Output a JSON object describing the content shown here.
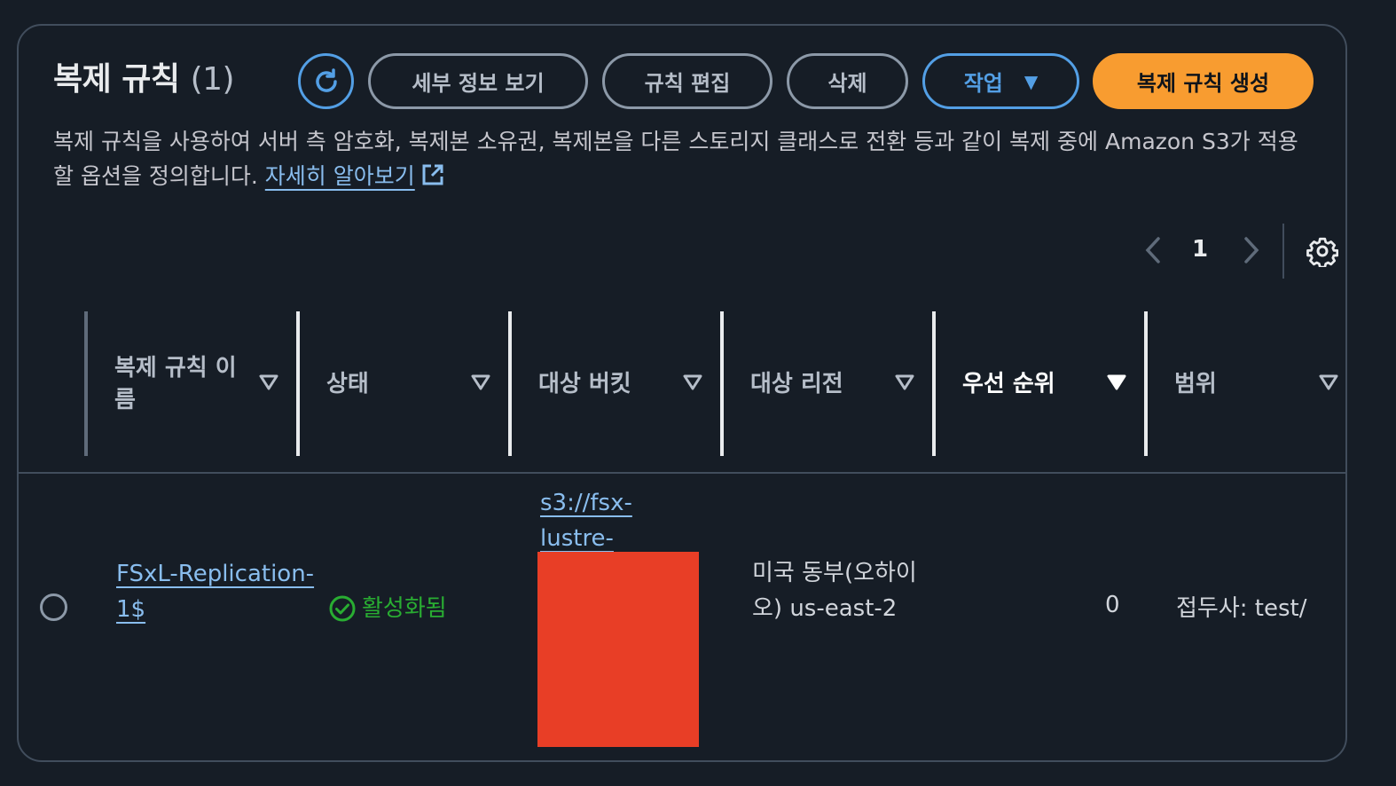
{
  "panel": {
    "title": "복제 규칙",
    "count": "(1)",
    "buttons": {
      "view_details": "세부 정보 보기",
      "edit_rule": "규칙 편집",
      "delete": "삭제",
      "actions": "작업",
      "create_rule": "복제 규칙 생성"
    },
    "description": "복제 규칙을 사용하여 서버 측 암호화, 복제본 소유권, 복제본을 다른 스토리지 클래스로 전환 등과 같이 복제 중에 Amazon S3가 적용할 옵션을 정의합니다.",
    "learn_more": "자세히 알아보기"
  },
  "pagination": {
    "current_page": "1"
  },
  "table": {
    "columns": [
      "복제 규칙 이름",
      "상태",
      "대상 버킷",
      "대상 리전",
      "우선 순위",
      "범위"
    ],
    "rows": [
      {
        "name": "FSxL-Replication-1$",
        "status": "활성화됨",
        "destination_bucket": "s3://fsx-lustre-",
        "destination_region": "미국 동부(오하이오) us-east-2",
        "priority": "0",
        "scope": "접두사: test/"
      }
    ]
  },
  "colors": {
    "background": "#161d26",
    "primary_button": "#f89c30",
    "link": "#89bdee",
    "status_active": "#29ad32",
    "redaction": "#e83e26"
  }
}
